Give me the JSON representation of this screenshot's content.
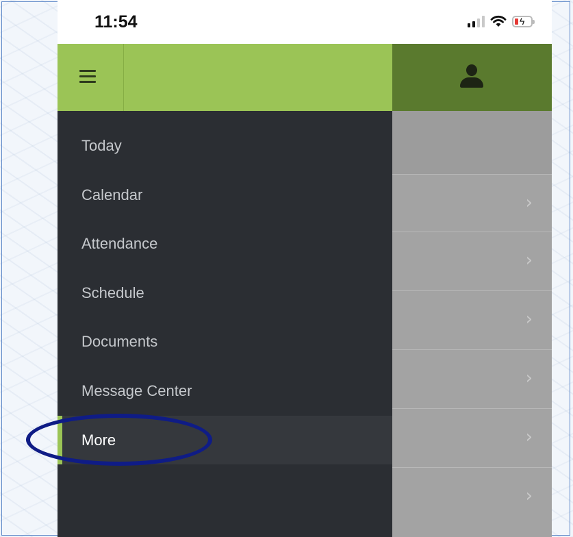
{
  "status_bar": {
    "time": "11:54",
    "icons": [
      "cellular-signal-icon",
      "wifi-icon",
      "battery-charging-icon"
    ]
  },
  "header": {
    "menu_icon": "hamburger-menu-icon",
    "profile_icon": "user-avatar-icon"
  },
  "drawer": {
    "items": [
      {
        "label": "Today",
        "active": false
      },
      {
        "label": "Calendar",
        "active": false
      },
      {
        "label": "Attendance",
        "active": false
      },
      {
        "label": "Schedule",
        "active": false
      },
      {
        "label": "Documents",
        "active": false
      },
      {
        "label": "Message Center",
        "active": true
      },
      {
        "label": "More",
        "active": true
      }
    ]
  },
  "content": {
    "row_icon": "chevron-right-icon",
    "row_chevron": "›"
  },
  "colors": {
    "header_green": "#9bc456",
    "header_dark_green": "#5a7a2e",
    "drawer_bg": "#2b2e33",
    "annotation_ellipse": "#0f1c86"
  }
}
